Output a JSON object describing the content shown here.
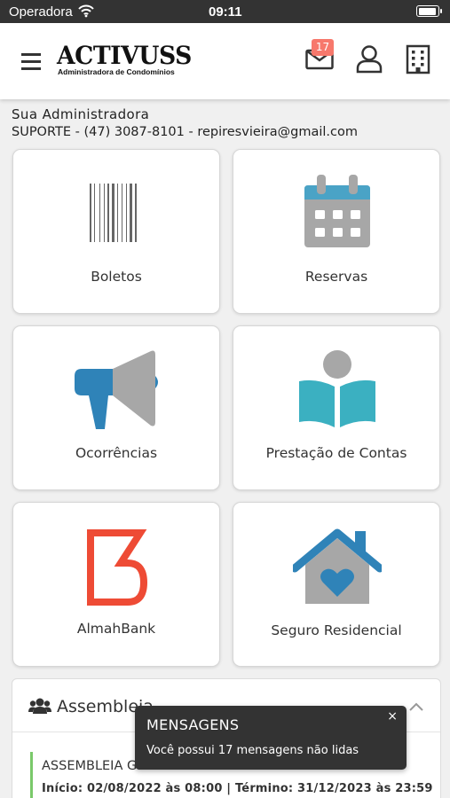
{
  "status_bar": {
    "carrier": "Operadora",
    "time": "09:11"
  },
  "header": {
    "logo_name": "ACTIVUSS",
    "logo_tagline": "Administradora de Condomínios",
    "message_badge": "17"
  },
  "admin": {
    "title": "Sua Administradora",
    "contact": "SUPORTE - (47) 3087-8101 - repiresvieira@gmail.com"
  },
  "menu": [
    {
      "label": "Boletos",
      "icon": "barcode-icon"
    },
    {
      "label": "Reservas",
      "icon": "calendar-icon"
    },
    {
      "label": "Ocorrências",
      "icon": "megaphone-icon"
    },
    {
      "label": "Prestação de Contas",
      "icon": "reading-book-icon"
    },
    {
      "label": "AlmahBank",
      "icon": "almahbank-logo-icon"
    },
    {
      "label": "Seguro Residencial",
      "icon": "house-heart-icon"
    }
  ],
  "assembly": {
    "title": "Assembleia",
    "item_title": "ASSEMBLEIA GERAL",
    "item_dates": "Início: 02/08/2022 às 08:00 | Término: 31/12/2023 às 23:59"
  },
  "toast": {
    "title": "MENSAGENS",
    "message": "Você possui 17 mensagens não lidas",
    "close": "×"
  },
  "colors": {
    "status_bar": "#333333",
    "badge": "#f7786c",
    "calendar_top": "#4aa3c6",
    "megaphone_blue": "#2f83b8",
    "book_teal": "#3bb0c1",
    "almah_red": "#ee4b35",
    "house_blue": "#2f83b8",
    "assembly_accent": "#7ac96a"
  }
}
